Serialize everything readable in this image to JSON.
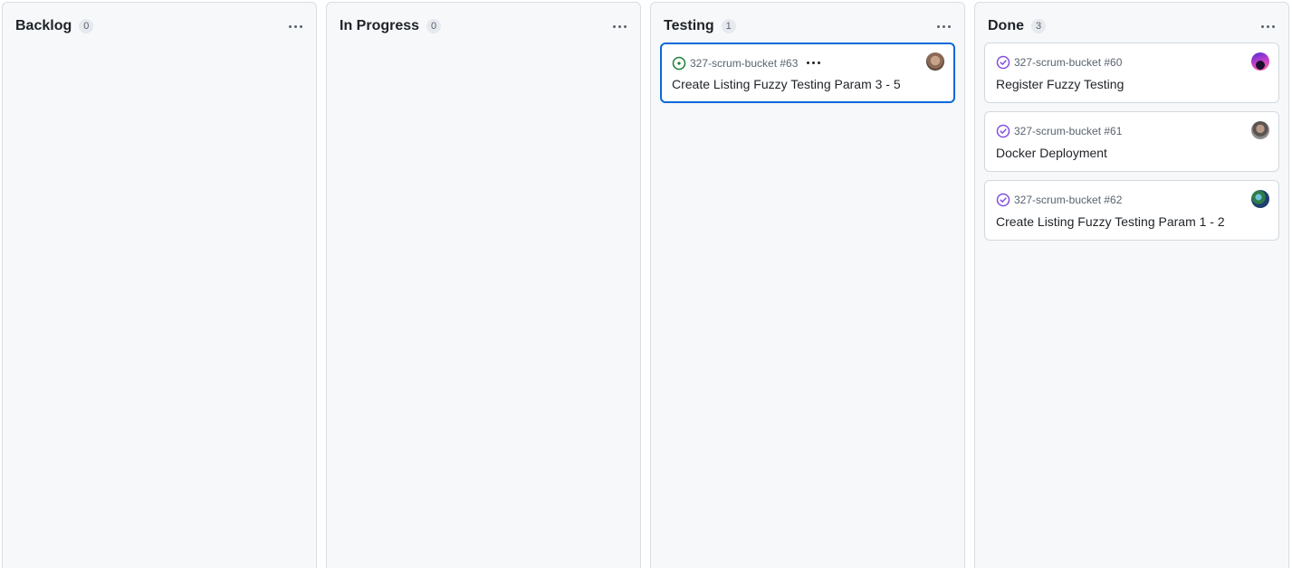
{
  "columns": [
    {
      "title": "Backlog",
      "count": "0",
      "cards": []
    },
    {
      "title": "In Progress",
      "count": "0",
      "cards": []
    },
    {
      "title": "Testing",
      "count": "1",
      "cards": [
        {
          "repo": "327-scrum-bucket #63",
          "title": "Create Listing Fuzzy Testing Param 3 - 5",
          "status": "open",
          "status_icon": "issue-open-icon",
          "avatar": "user-avatar",
          "selected": true
        }
      ]
    },
    {
      "title": "Done",
      "count": "3",
      "cards": [
        {
          "repo": "327-scrum-bucket #60",
          "title": "Register Fuzzy Testing",
          "status": "closed",
          "status_icon": "issue-closed-icon",
          "avatar": "user-avatar"
        },
        {
          "repo": "327-scrum-bucket #61",
          "title": "Docker Deployment",
          "status": "closed",
          "status_icon": "issue-closed-icon",
          "avatar": "user-avatar"
        },
        {
          "repo": "327-scrum-bucket #62",
          "title": "Create Listing Fuzzy Testing Param 1 - 2",
          "status": "closed",
          "status_icon": "issue-closed-icon",
          "avatar": "user-avatar"
        }
      ]
    }
  ],
  "colors": {
    "open": "#1a7f37",
    "closed": "#8250df",
    "selected_border": "#0969da",
    "column_bg": "#f6f8fa"
  }
}
